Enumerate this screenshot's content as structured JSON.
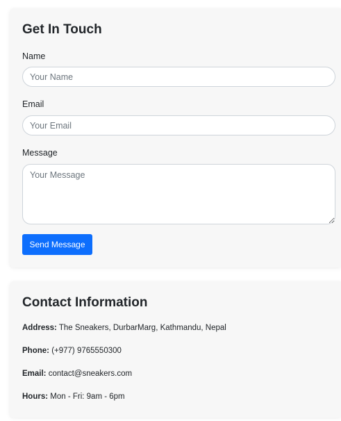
{
  "contact_form": {
    "title": "Get In Touch",
    "name_label": "Name",
    "name_placeholder": "Your Name",
    "email_label": "Email",
    "email_placeholder": "Your Email",
    "message_label": "Message",
    "message_placeholder": "Your Message",
    "submit_label": "Send Message"
  },
  "contact_info": {
    "title": "Contact Information",
    "address_label": "Address:",
    "address_value": "The Sneakers, DurbarMarg, Kathmandu, Nepal",
    "phone_label": "Phone:",
    "phone_value": "(+977) 9765550300",
    "email_label": "Email:",
    "email_value": "contact@sneakers.com",
    "hours_label": "Hours:",
    "hours_value": "Mon - Fri: 9am - 6pm"
  },
  "colors": {
    "primary_button": "#0d6efd",
    "card_background": "#f7f7f7"
  }
}
